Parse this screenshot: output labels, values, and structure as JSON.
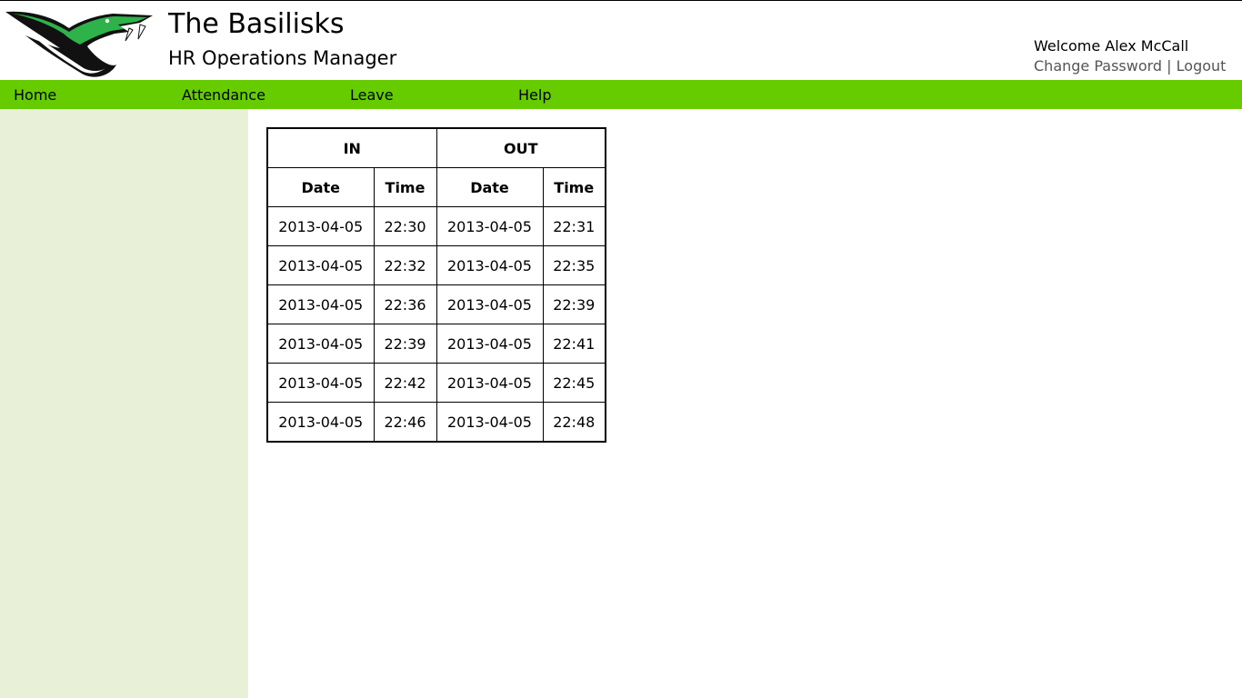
{
  "header": {
    "title": "The Basilisks",
    "subtitle": "HR Operations Manager",
    "logo": "basilisk-snake-logo"
  },
  "user": {
    "welcome": "Welcome Alex McCall",
    "change_password": "Change Password",
    "separator": "|",
    "logout": "Logout"
  },
  "nav": {
    "home": "Home",
    "attendance": "Attendance",
    "leave": "Leave",
    "help": "Help"
  },
  "colors": {
    "nav_green": "#66cc00",
    "sidebar_bg": "#e8f1d7",
    "logo_green": "#2db34a"
  },
  "table": {
    "group_in": "IN",
    "group_out": "OUT",
    "col_date": "Date",
    "col_time": "Time",
    "rows": [
      {
        "in_date": "2013-04-05",
        "in_time": "22:30",
        "out_date": "2013-04-05",
        "out_time": "22:31"
      },
      {
        "in_date": "2013-04-05",
        "in_time": "22:32",
        "out_date": "2013-04-05",
        "out_time": "22:35"
      },
      {
        "in_date": "2013-04-05",
        "in_time": "22:36",
        "out_date": "2013-04-05",
        "out_time": "22:39"
      },
      {
        "in_date": "2013-04-05",
        "in_time": "22:39",
        "out_date": "2013-04-05",
        "out_time": "22:41"
      },
      {
        "in_date": "2013-04-05",
        "in_time": "22:42",
        "out_date": "2013-04-05",
        "out_time": "22:45"
      },
      {
        "in_date": "2013-04-05",
        "in_time": "22:46",
        "out_date": "2013-04-05",
        "out_time": "22:48"
      }
    ]
  }
}
